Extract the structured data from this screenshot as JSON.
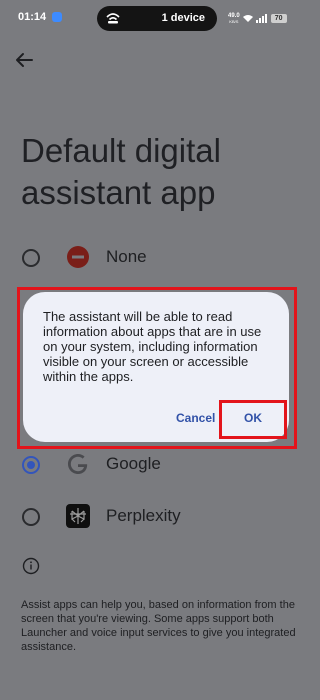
{
  "status_bar": {
    "time": "01:14",
    "pill_text": "1 device",
    "net_speed": "49.0",
    "net_unit": "KB/S",
    "battery": "70"
  },
  "page": {
    "title": "Default digital assistant app",
    "options": [
      {
        "label": "None",
        "selected": false,
        "icon": "none-icon"
      },
      {
        "label": "Google",
        "selected": true,
        "icon": "google-icon"
      },
      {
        "label": "Perplexity",
        "selected": false,
        "icon": "perplexity-icon"
      }
    ],
    "footer_text": "Assist apps can help you, based on information from the screen that you're viewing. Some apps support both Launcher and voice input services to give you integrated assistance."
  },
  "dialog": {
    "body": "The assistant will be able to read information about apps that are in use on your system, including information visible on your screen or accessible within the apps.",
    "cancel_label": "Cancel",
    "ok_label": "OK"
  },
  "colors": {
    "highlight": "#e3141b",
    "accent": "#3252a8",
    "scrim": "#7a7b7f"
  }
}
